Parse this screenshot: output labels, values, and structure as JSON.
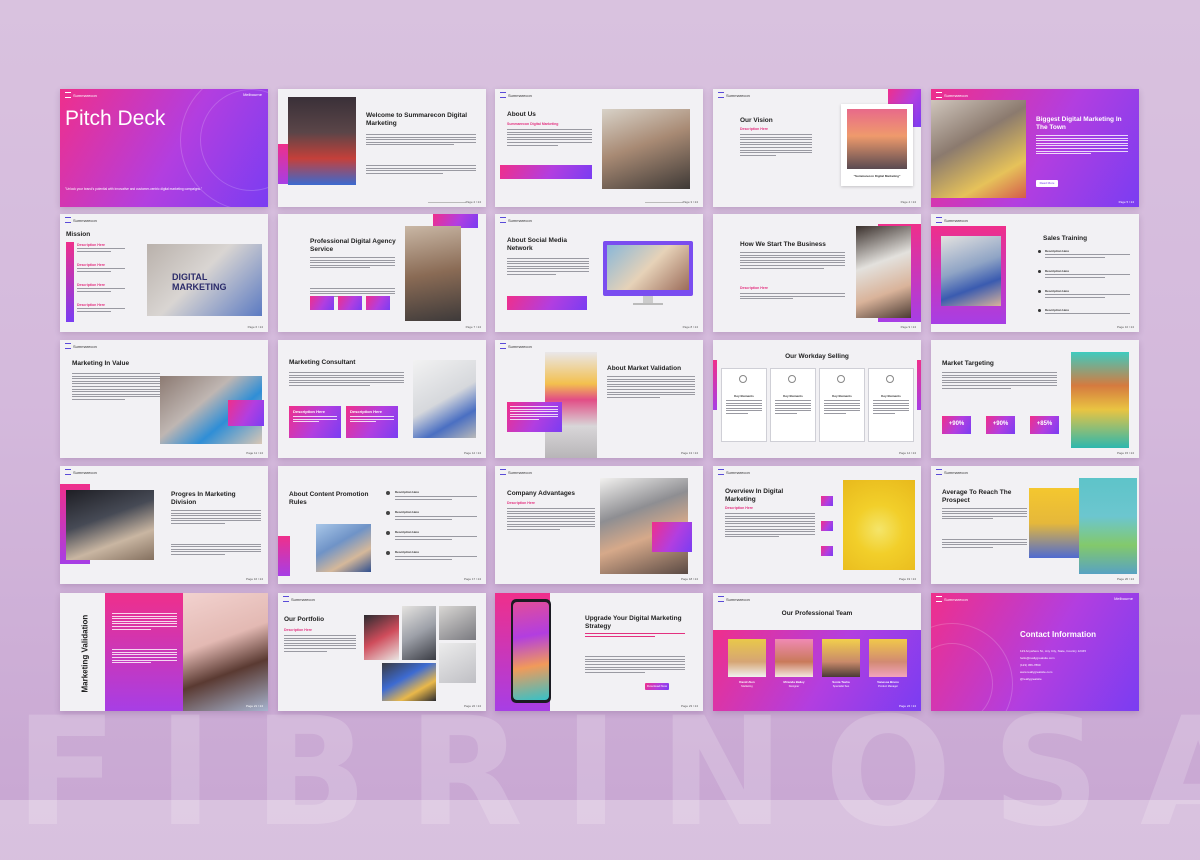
{
  "brand": "Summarecon",
  "location": "Melbourne",
  "watermark": "FIBRINOSA",
  "colors": {
    "pink": "#ef2f8b",
    "purple": "#9b3ee6",
    "violet": "#7a3df2",
    "background": "#d6bcdc"
  },
  "s1": {
    "title": "Pitch Deck",
    "tagline": "\"Unlock your brand's potential with innovative and customer-centric digital marketing campaigns.\""
  },
  "s2": {
    "title": "Welcome to Summarecon Digital Marketing",
    "page": "Page 2 / 24"
  },
  "s3": {
    "title": "About Us",
    "subtitle": "Summarecon Digital Marketing",
    "page": "Page 3 / 24"
  },
  "s4": {
    "title": "Our Vision",
    "subtitle": "Description Here",
    "caption": "\"Summarecon Digital Marketing\"",
    "page": "Page 4 / 24"
  },
  "s5": {
    "title": "Biggest Digital Marketing In The Town",
    "button": "Read More",
    "page": "Page 5 / 24"
  },
  "s6": {
    "title": "Mission",
    "items": [
      "Description Here",
      "Description Here",
      "Description Here",
      "Description Here"
    ],
    "photo_text": "DIGITAL MARKETING",
    "page": "Page 6 / 24"
  },
  "s7": {
    "title": "Professional Digital Agency Service",
    "page": "Page 7 / 24"
  },
  "s8": {
    "title": "About Social Media Network",
    "page": "Page 8 / 24"
  },
  "s9": {
    "title": "How We Start The Business",
    "subtitle": "Description Here",
    "page": "Page 9 / 24"
  },
  "s10": {
    "title": "Sales Training",
    "items": [
      "Description Here",
      "Description Here",
      "Description Here",
      "Description Here"
    ],
    "page": "Page 10 / 24"
  },
  "s11": {
    "title": "Marketing In Value",
    "page": "Page 11 / 24"
  },
  "s12": {
    "title": "Marketing Consultant",
    "boxes": [
      "Description Here",
      "Description Here"
    ],
    "page": "Page 12 / 24"
  },
  "s13": {
    "title": "About Market Validation",
    "page": "Page 13 / 24"
  },
  "s14": {
    "title": "Our Workday Selling",
    "cards": [
      "Key Elements",
      "Key Elements",
      "Key Elements",
      "Key Elements"
    ],
    "page": "Page 14 / 24"
  },
  "s15": {
    "title": "Market Targeting",
    "stats": [
      "+90%",
      "+90%",
      "+85%"
    ],
    "page": "Page 15 / 24"
  },
  "s16": {
    "title": "Progres In Marketing Division",
    "page": "Page 16 / 24"
  },
  "s17": {
    "title": "About Content Promotion Rules",
    "items": [
      "Description Here",
      "Description Here",
      "Description Here",
      "Description Here"
    ],
    "page": "Page 17 / 24"
  },
  "s18": {
    "title": "Company Advantages",
    "subtitle": "Description Here",
    "page": "Page 18 / 24"
  },
  "s19": {
    "title": "Overview In Digital Marketing",
    "subtitle": "Description Here",
    "page": "Page 19 / 24"
  },
  "s20": {
    "title": "Average To Reach The Prospect",
    "page": "Page 20 / 24"
  },
  "s21": {
    "title": "Marketing Validation",
    "page": "Page 21 / 24"
  },
  "s22": {
    "title": "Our Portfolio",
    "subtitle": "Description Here",
    "page": "Page 22 / 24"
  },
  "s23": {
    "title": "Upgrade Your Digital Marketing Strategy",
    "button": "Download Now",
    "page": "Page 23 / 24"
  },
  "s24": {
    "title": "Our Professional Team",
    "members": [
      {
        "name": "David Alen",
        "role": "Marketing"
      },
      {
        "name": "Miranda Bailey",
        "role": "Designer"
      },
      {
        "name": "Sonia Tasha",
        "role": "Specialist Seo"
      },
      {
        "name": "Vanessa Bruno",
        "role": "Product Manager"
      }
    ],
    "page": "Page 24 / 24"
  },
  "s25": {
    "title": "Contact Information",
    "lines": [
      "123 Anywhere St., Any City, State, Country 12345",
      "hello@reallygreatsite.com",
      "(123) 456-7890",
      "www.reallygreatsite.com",
      "@reallygreatsite"
    ]
  }
}
